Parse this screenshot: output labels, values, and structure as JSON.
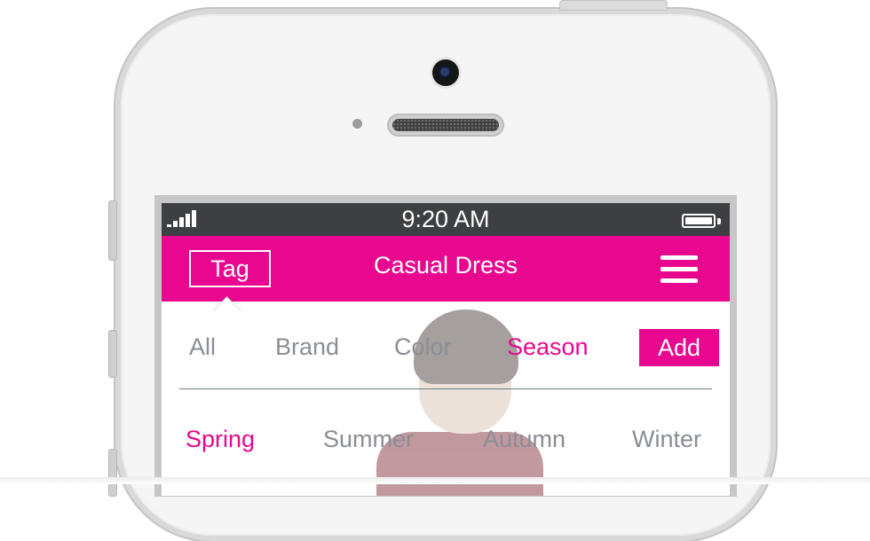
{
  "status_bar": {
    "time": "9:20 AM"
  },
  "nav_bar": {
    "tag_label": "Tag",
    "title": "Casual Dress"
  },
  "filter_tabs": {
    "items": [
      "All",
      "Brand",
      "Color",
      "Season"
    ],
    "active": "Season",
    "add_label": "Add"
  },
  "seasons": {
    "items": [
      "Spring",
      "Summer",
      "Autumn",
      "Winter"
    ],
    "active": "Spring"
  },
  "colors": {
    "accent": "#e8078e",
    "status_bar": "#3e3f42",
    "inactive_text": "#8a8e96"
  },
  "icons": [
    "signal-icon",
    "battery-icon",
    "menu-icon"
  ]
}
